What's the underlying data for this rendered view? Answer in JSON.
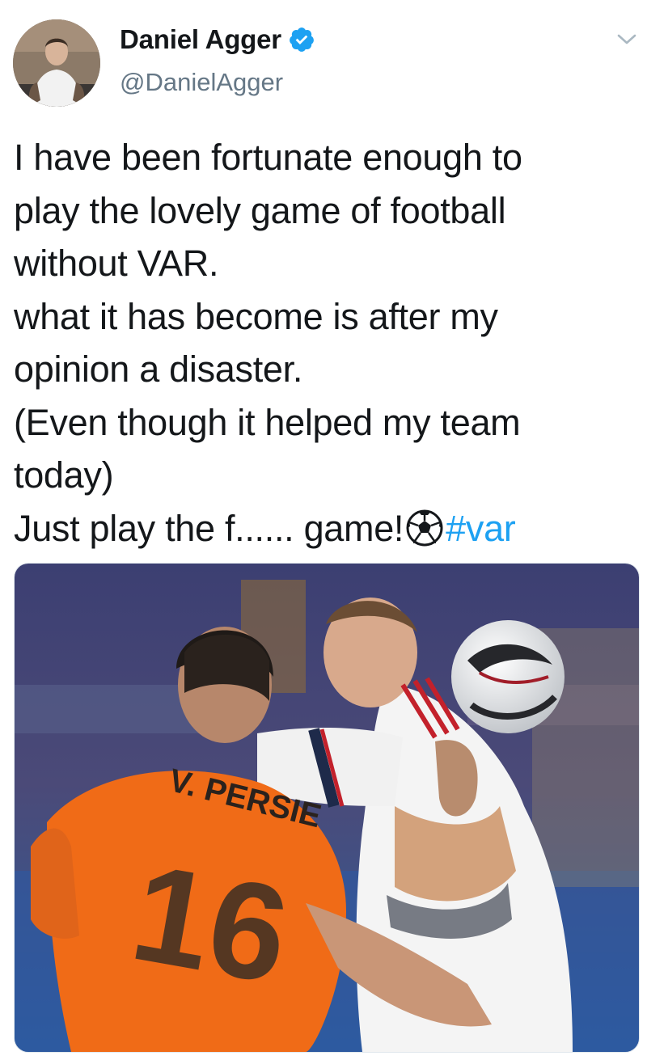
{
  "header": {
    "display_name": "Daniel Agger",
    "handle": "@DanielAgger",
    "verified": true,
    "avatar_icon": "profile-photo",
    "menu_icon": "chevron-down-icon"
  },
  "tweet": {
    "lines": [
      "I have been fortunate enough to",
      "play the lovely game of football",
      "without VAR.",
      "what it has become is after my",
      "opinion a disaster.",
      "(Even though it helped my team",
      "today)"
    ],
    "last_line_text": "Just play the f...... game!",
    "emoji": "soccer-ball-icon",
    "hashtag": "#var"
  },
  "media": {
    "jersey_name": "V. PERSIE",
    "jersey_number": "16"
  },
  "colors": {
    "accent": "#1da1f2",
    "text": "#14171a",
    "secondary": "#657786",
    "jersey_orange": "#f06b17"
  }
}
